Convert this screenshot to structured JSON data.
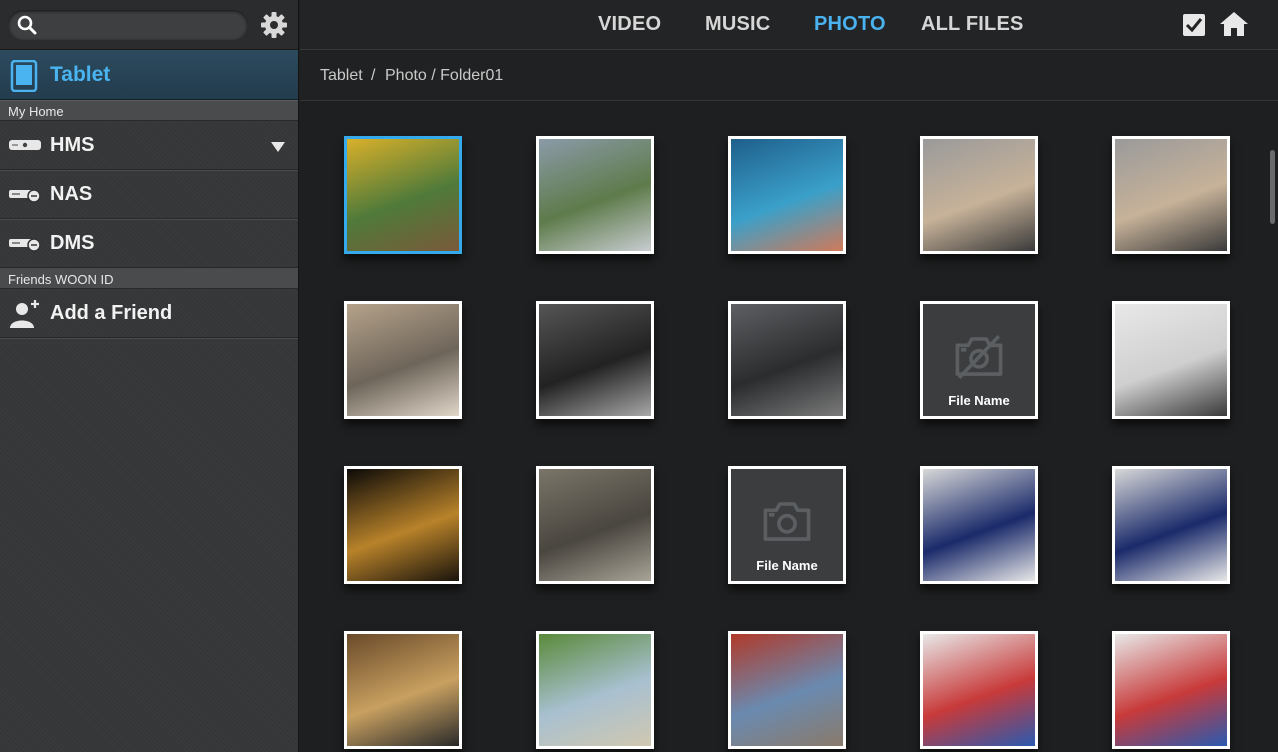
{
  "search": {
    "value": "",
    "placeholder": ""
  },
  "device": {
    "label": "Tablet"
  },
  "sidebar": {
    "sections": [
      {
        "header": "My Home"
      },
      {
        "header": "Friends WOON ID"
      }
    ],
    "home_items": [
      {
        "label": "HMS",
        "icon": "server-icon"
      },
      {
        "label": "NAS",
        "icon": "nas-icon"
      },
      {
        "label": "DMS",
        "icon": "dms-icon"
      }
    ],
    "friend_item": {
      "label": "Add a Friend",
      "icon": "add-friend-icon"
    }
  },
  "nav": {
    "tabs": [
      {
        "label": "VIDEO",
        "active": false
      },
      {
        "label": "MUSIC",
        "active": false
      },
      {
        "label": "PHOTO",
        "active": true
      },
      {
        "label": "ALL FILES",
        "active": false
      }
    ]
  },
  "breadcrumb": {
    "root": "Tablet",
    "sep": "/",
    "path": "Photo / Folder01"
  },
  "colors": {
    "accent": "#4ab2ee",
    "selected_border": "#34a9ec"
  },
  "photos": [
    {
      "kind": "photo",
      "selected": true
    },
    {
      "kind": "photo"
    },
    {
      "kind": "photo"
    },
    {
      "kind": "photo"
    },
    {
      "kind": "photo"
    },
    {
      "kind": "photo"
    },
    {
      "kind": "photo"
    },
    {
      "kind": "photo"
    },
    {
      "kind": "placeholder-broken",
      "label": "File Name"
    },
    {
      "kind": "photo"
    },
    {
      "kind": "photo"
    },
    {
      "kind": "photo"
    },
    {
      "kind": "placeholder-camera",
      "label": "File Name"
    },
    {
      "kind": "photo"
    },
    {
      "kind": "photo"
    },
    {
      "kind": "photo"
    },
    {
      "kind": "photo"
    },
    {
      "kind": "photo"
    },
    {
      "kind": "photo"
    },
    {
      "kind": "photo"
    }
  ]
}
